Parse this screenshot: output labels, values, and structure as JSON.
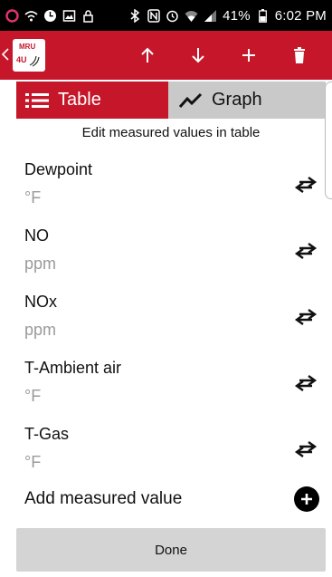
{
  "status_bar": {
    "battery": "41%",
    "time": "6:02 PM"
  },
  "app_bar": {
    "logo_top": "MRU",
    "logo_bottom": "4U"
  },
  "tabs": [
    {
      "label": "Table",
      "active": true
    },
    {
      "label": "Graph",
      "active": false
    }
  ],
  "subtitle": "Edit measured values in table",
  "measurements": [
    {
      "name": "Dewpoint",
      "unit": "°F"
    },
    {
      "name": "NO",
      "unit": "ppm"
    },
    {
      "name": "NOx",
      "unit": "ppm"
    },
    {
      "name": "T-Ambient air",
      "unit": "°F"
    },
    {
      "name": "T-Gas",
      "unit": "°F"
    }
  ],
  "add_label": "Add measured value",
  "done_label": "Done",
  "colors": {
    "accent": "#c5162a",
    "tab_inactive": "#c9c9c9",
    "unit_text": "#9a9a9a",
    "done_bg": "#d4d4d4"
  }
}
